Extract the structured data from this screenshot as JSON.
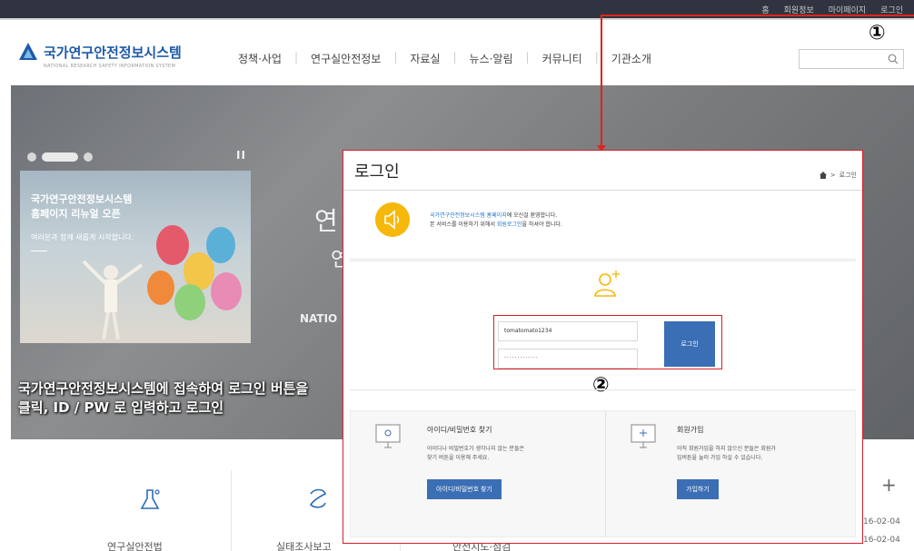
{
  "util_links": [
    "홈",
    "회원정보",
    "마이페이지",
    "로그인"
  ],
  "logo": {
    "name": "국가연구안전정보시스템",
    "sub": "NATIONAL RESEARCH SAFETY INFORMATION SYSTEM"
  },
  "gnb": [
    "정책·사업",
    "연구실안전정보",
    "자료실",
    "뉴스·알림",
    "커뮤니티",
    "기관소개"
  ],
  "search": {
    "placeholder": ""
  },
  "hero": {
    "promo_title": "국가연구안전정보시스템\n홈페이지 리뉴얼 오픈",
    "promo_sub": "여러분과 함께 새롭게 시작합니다.",
    "big_text_1": "연",
    "big_text_2": "연",
    "nation": "NATIO",
    "pause": "II"
  },
  "caption": "국가연구안전정보시스템에 접속하여 로그인 버튼을\n클릭, ID / PW 로 입력하고 로그인",
  "annotation": {
    "step1": "①",
    "step2": "②"
  },
  "popup": {
    "title": "로그인",
    "breadcrumb": "로그인",
    "welcome": {
      "line1_hl": "국가연구안전정보시스템 홈페이지",
      "line1_rest": "에 오신걸 환영합니다.",
      "line2_pre": "본 서비스를 이용하기 위해서 ",
      "line2_hl": "회원로그인",
      "line2_rest": "을 하셔야 합니다."
    },
    "id_value": "tomatomato1234",
    "pw_value": "·············",
    "login_button": "로그인",
    "find": {
      "title": "아이디/비밀번호 찾기",
      "desc": "아이디나 비밀번호가 생각나지 않는 분들은\n찾기 버튼을 이용해 주세요.",
      "button": "아이디/비밀번호 찾기"
    },
    "join": {
      "title": "회원가입",
      "desc": "아직 회원가입을 하지 않으신 분들은 회원가\n입버튼을 눌러 가입 하실 수 있습니다.",
      "button": "가입하기"
    }
  },
  "bottom": {
    "labels": [
      "연구실안전법",
      "실태조사보고",
      "안전지도·점검"
    ],
    "plus": "+",
    "dates": [
      "16-02-04",
      "16-02-04"
    ]
  },
  "colors": {
    "accent_red": "#e0231c",
    "brand_blue": "#1e5aa8",
    "button_blue": "#3a6eb5",
    "speaker_yellow": "#f6b80b"
  }
}
